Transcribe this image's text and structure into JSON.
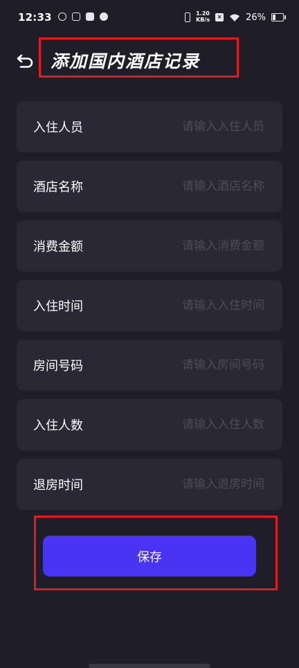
{
  "status_bar": {
    "time": "12:33",
    "net_speed_value": "1.20",
    "net_speed_unit": "KB/s",
    "battery_percent": "26%",
    "battery_level": 0.26
  },
  "header": {
    "title": "添加国内酒店记录"
  },
  "form": {
    "fields": [
      {
        "label": "入住人员",
        "placeholder": "请输入入住人员",
        "value": ""
      },
      {
        "label": "酒店名称",
        "placeholder": "请输入酒店名称",
        "value": ""
      },
      {
        "label": "消费金额",
        "placeholder": "请输入消费金额",
        "value": ""
      },
      {
        "label": "入住时间",
        "placeholder": "请输入入住时间",
        "value": ""
      },
      {
        "label": "房间号码",
        "placeholder": "请输入房间号码",
        "value": ""
      },
      {
        "label": "入住人数",
        "placeholder": "请输入入住人数",
        "value": ""
      },
      {
        "label": "退房时间",
        "placeholder": "请输入退房时间",
        "value": ""
      }
    ]
  },
  "actions": {
    "save_label": "保存"
  },
  "colors": {
    "background": "#1f1d27",
    "card": "#2a2834",
    "primary": "#4834f2",
    "highlight_border": "#e21a22",
    "placeholder": "#4f4c5a"
  }
}
